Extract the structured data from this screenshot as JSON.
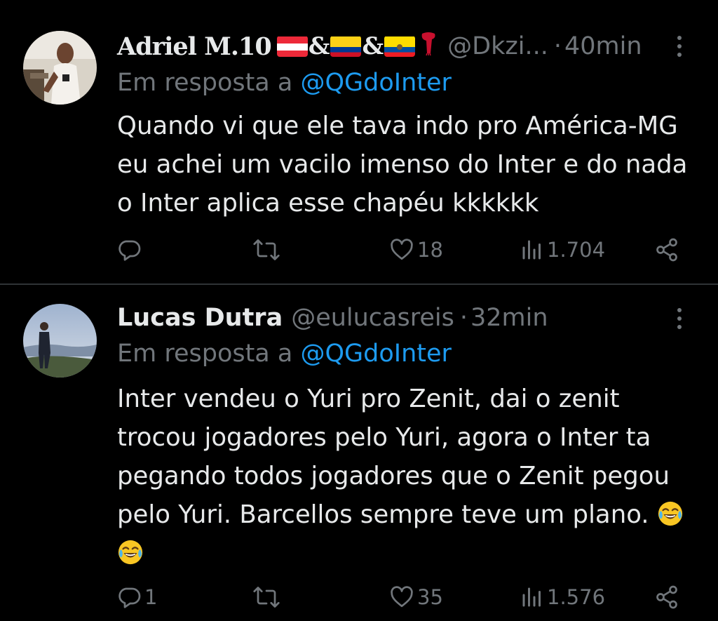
{
  "tweets": [
    {
      "name": "Adriel M.10",
      "flag_separator": "&",
      "handle": "@Dkzi...",
      "dot": "·",
      "time": "40min",
      "reply_prefix": "Em resposta a",
      "reply_mention": "@QGdoInter",
      "text_lines": [
        "Quando vi que ele tava indo pro América-MG",
        "eu achei um vacilo imenso do Inter e do nada",
        "o Inter aplica esse chapéu kkkkkk"
      ],
      "replies": "",
      "retweets": "",
      "likes": "18",
      "views": "1.704",
      "icons": [
        "reply-icon",
        "retweet-icon",
        "heart-icon",
        "views-icon",
        "share-icon"
      ]
    },
    {
      "name": "Lucas Dutra",
      "handle": "@eulucasreis",
      "dot": "·",
      "time": "32min",
      "reply_prefix": "Em resposta a",
      "reply_mention": "@QGdoInter",
      "text_lines": [
        "Inter vendeu o Yuri pro Zenit, dai o zenit",
        "trocou jogadores pelo Yuri, agora o Inter ta",
        "pegando todos jogadores que o Zenit pegou",
        "pelo Yuri. Barcellos sempre teve um plano."
      ],
      "emoji": "face-with-tears-of-joy",
      "replies": "1",
      "retweets": "",
      "likes": "35",
      "views": "1.576",
      "icons": [
        "reply-icon",
        "retweet-icon",
        "heart-icon",
        "views-icon",
        "share-icon"
      ]
    }
  ],
  "colors": {
    "background": "#000000",
    "text": "#e7e9ea",
    "secondary": "#71767b",
    "mention": "#1d9bf0",
    "divider": "#2f3336"
  }
}
